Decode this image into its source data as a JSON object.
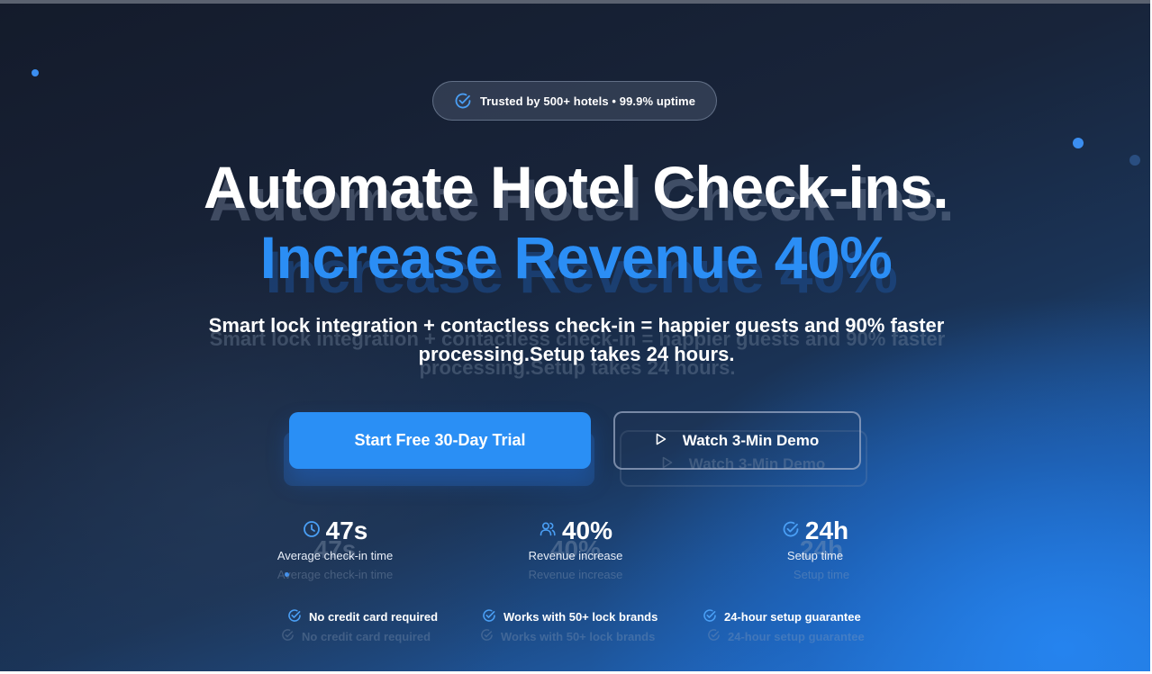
{
  "badge": {
    "icon": "check-circle-icon",
    "text": "Trusted by 500+ hotels • 99.9% uptime"
  },
  "hero": {
    "title_line1": "Automate Hotel Check-ins.",
    "title_line2": "Increase Revenue 40%",
    "subtitle_line1": "Smart lock integration + contactless check-in = happier guests and 90% faster",
    "subtitle_line2": "processing.Setup takes 24 hours."
  },
  "cta": {
    "primary_label": "Start Free 30-Day Trial",
    "secondary_label": "Watch 3-Min Demo",
    "secondary_icon": "play-icon"
  },
  "stats": [
    {
      "icon": "clock-icon",
      "value": "47s",
      "label": "Average check-in time"
    },
    {
      "icon": "users-icon",
      "value": "40%",
      "label": "Revenue increase"
    },
    {
      "icon": "check-circle-icon",
      "value": "24h",
      "label": "Setup time"
    }
  ],
  "features": [
    {
      "icon": "check-circle-icon",
      "label": "No credit card required"
    },
    {
      "icon": "check-circle-icon",
      "label": "Works with 50+ lock brands"
    },
    {
      "icon": "check-circle-icon",
      "label": "24-hour setup guarantee"
    }
  ],
  "colors": {
    "accent": "#2a8ff5",
    "background_dark": "#141b2b",
    "background_blue": "#2a86e8"
  }
}
